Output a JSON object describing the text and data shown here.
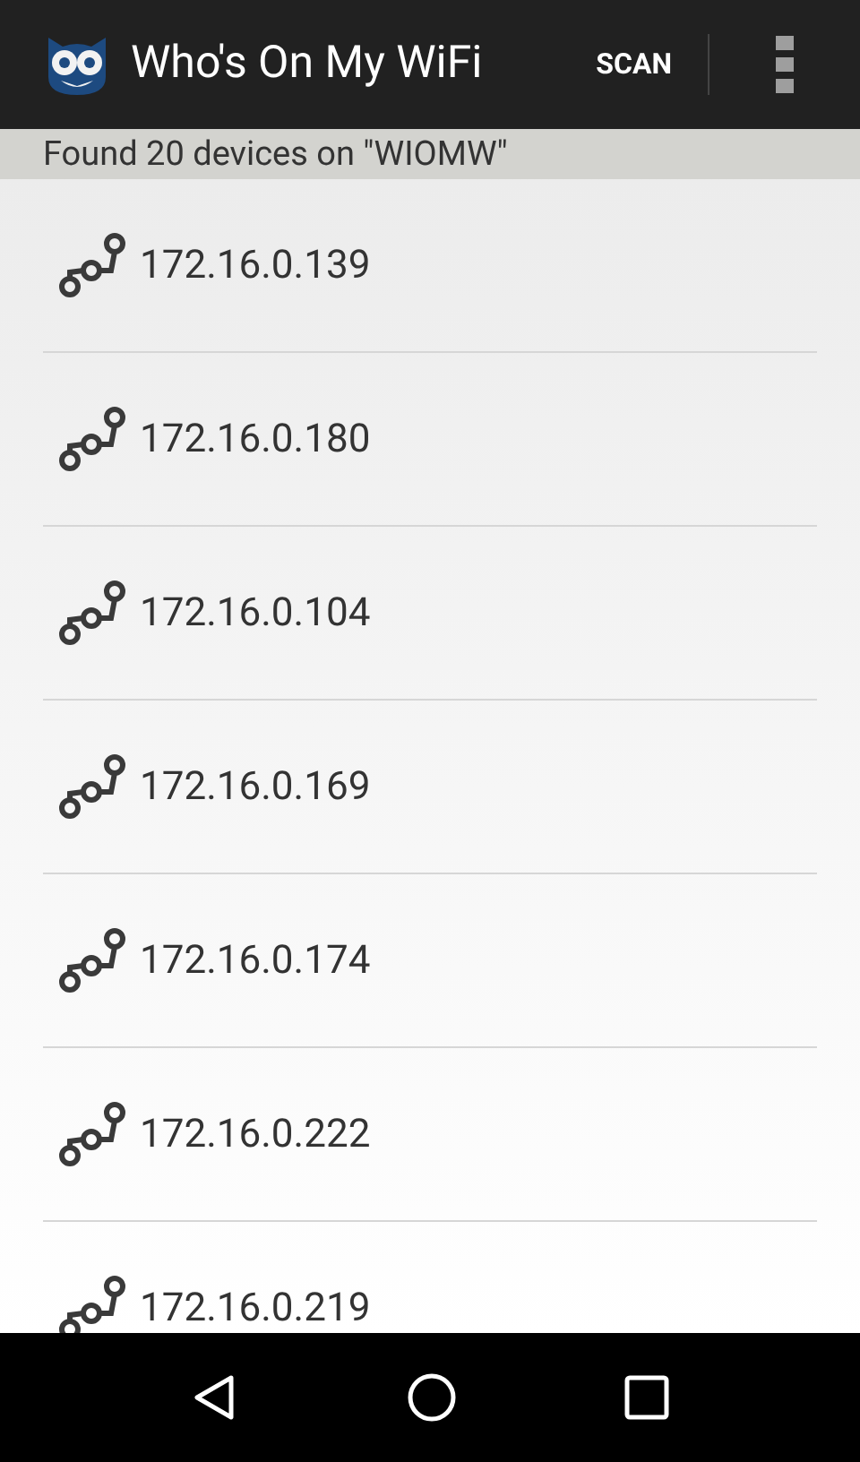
{
  "app_bar": {
    "title": "Who's On My WiFi",
    "action": "SCAN"
  },
  "summary": "Found 20 devices on \"WIOMW\"",
  "devices": [
    {
      "ip": "172.16.0.139"
    },
    {
      "ip": "172.16.0.180"
    },
    {
      "ip": "172.16.0.104"
    },
    {
      "ip": "172.16.0.169"
    },
    {
      "ip": "172.16.0.174"
    },
    {
      "ip": "172.16.0.222"
    },
    {
      "ip": "172.16.0.219"
    }
  ]
}
